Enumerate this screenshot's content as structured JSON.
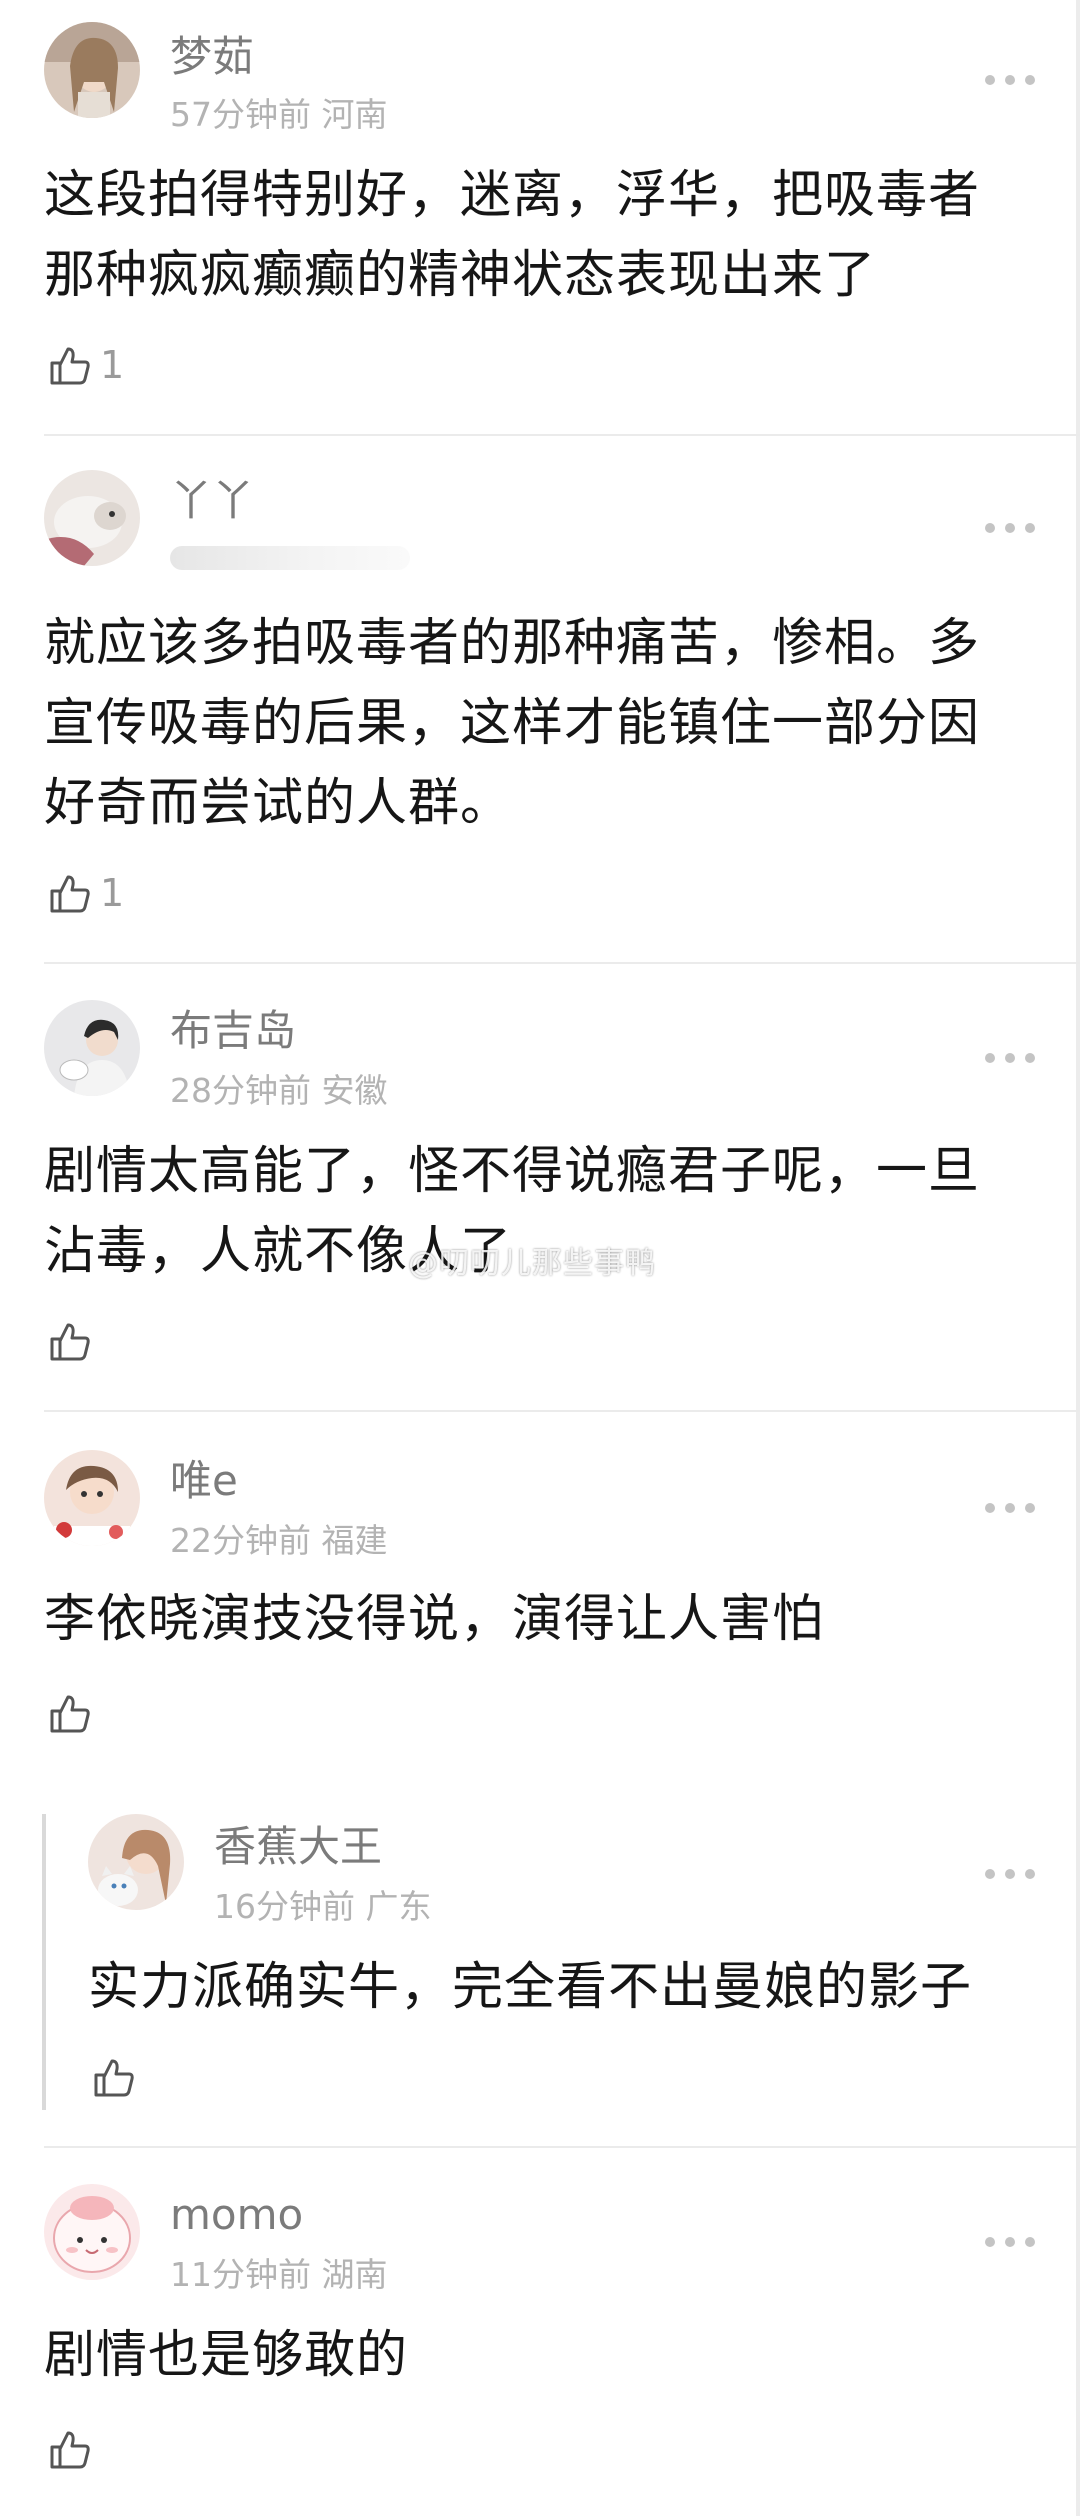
{
  "comments": [
    {
      "name": "梦茹",
      "time": "57分钟前",
      "location": "河南",
      "text_lines": [
        "这段拍得特别好，迷离，浮华，把吸毒者",
        "那种疯疯癫癫的精神状态表现出来了"
      ],
      "likes": "1"
    },
    {
      "name": "丫丫",
      "time": "",
      "location": "",
      "text_lines": [
        "就应该多拍吸毒者的那种痛苦，惨相。多",
        "宣传吸毒的后果，这样才能镇住一部分因",
        "好奇而尝试的人群。"
      ],
      "likes": "1"
    },
    {
      "name": "布吉岛",
      "time": "28分钟前",
      "location": "安徽",
      "text_lines": [
        "剧情太高能了，怪不得说瘾君子呢，一旦",
        "沾毒，人就不像人了"
      ],
      "likes": ""
    },
    {
      "name": "唯e",
      "time": "22分钟前",
      "location": "福建",
      "text_lines": [
        "李依晓演技没得说，演得让人害怕"
      ],
      "likes": ""
    },
    {
      "name": "香蕉大王",
      "time": "16分钟前",
      "location": "广东",
      "text_lines": [
        "实力派确实牛，完全看不出曼娘的影子"
      ],
      "likes": ""
    },
    {
      "name": "momo",
      "time": "11分钟前",
      "location": "湖南",
      "text_lines": [
        "剧情也是够敢的"
      ],
      "likes": ""
    }
  ],
  "watermark": "@叨叨儿那些事鸭",
  "colors": {
    "name": "#7b7b7b",
    "meta": "#b3b3b3",
    "text": "#161616",
    "divider": "#ebebeb"
  },
  "icons": {
    "more": "more-dots-icon",
    "like": "thumbs-up-icon",
    "avatar": "avatar"
  }
}
